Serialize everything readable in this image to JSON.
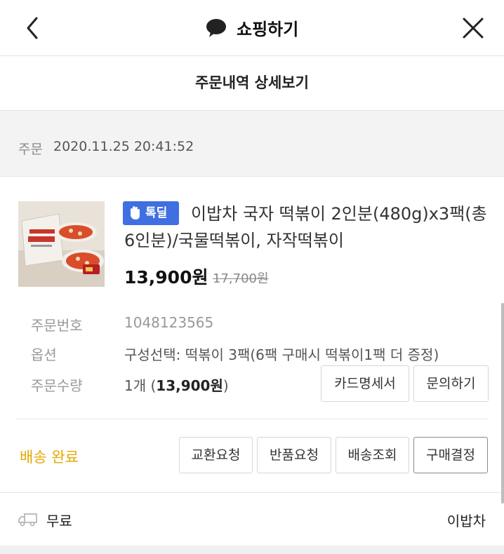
{
  "header": {
    "title": "쇼핑하기",
    "back_icon": "chevron-left-icon",
    "close_icon": "close-icon"
  },
  "subheader": {
    "title": "주문내역 상세보기"
  },
  "order": {
    "date_label": "주문",
    "date_value": "2020.11.25 20:41:52"
  },
  "product": {
    "badge": "톡딜",
    "title": "이밥차 국자 떡볶이 2인분(480g)x3팩(총 6인분)/국물떡볶이, 자작떡볶이",
    "price": "13,900원",
    "original_price": "17,700원"
  },
  "details": {
    "order_number_label": "주문번호",
    "order_number_value": "1048123565",
    "option_label": "옵션",
    "option_value": "구성선택: 떡볶이 3팩(6팩 구매시 떡볶이1팩 더 증정)",
    "quantity_label": "주문수량",
    "quantity_value_prefix": "1개 (",
    "quantity_value_amount": "13,900원",
    "quantity_value_suffix": ")"
  },
  "buttons": {
    "card_statement": "카드명세서",
    "inquiry": "문의하기",
    "exchange": "교환요청",
    "return": "반품요청",
    "tracking": "배송조회",
    "confirm_purchase": "구매결정"
  },
  "status": {
    "label": "배송 완료",
    "color": "#e5a800"
  },
  "footer": {
    "shipping": "무료",
    "seller": "이밥차"
  },
  "colors": {
    "badge_bg": "#3f6fe0",
    "status": "#e5a800"
  }
}
